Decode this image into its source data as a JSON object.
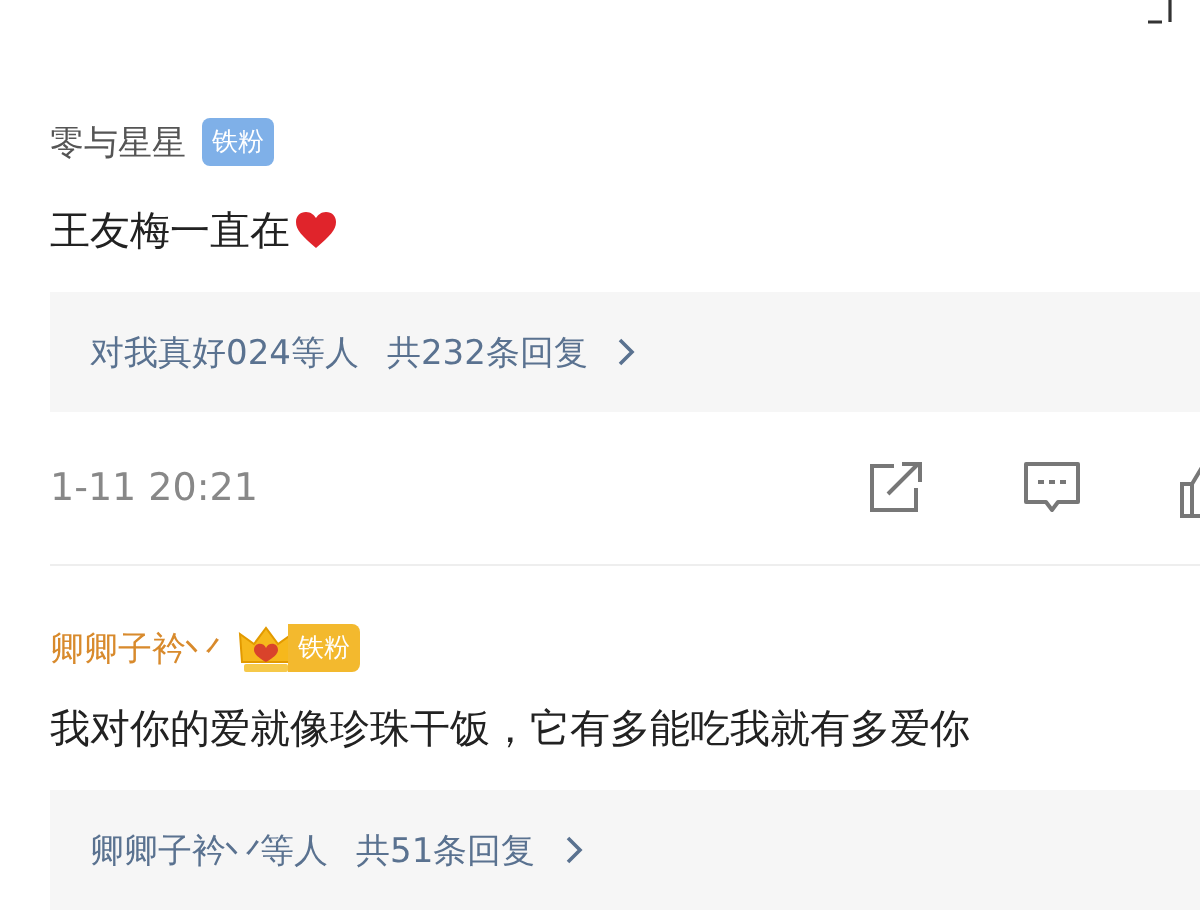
{
  "comments": [
    {
      "user": "零与星星",
      "badge": {
        "kind": "plain",
        "label": "铁粉"
      },
      "text": "王友梅一直在",
      "heart": true,
      "replies": {
        "users": "对我真好024等人",
        "count": "共232条回复"
      },
      "time": "1-11 20:21"
    },
    {
      "user": "卿卿子衿丷",
      "badge": {
        "kind": "crown",
        "label": "铁粉"
      },
      "text": "我对你的爱就像珍珠干饭，它有多能吃我就有多爱你",
      "replies": {
        "users": "卿卿子衿丷等人",
        "count": "共51条回复"
      }
    }
  ]
}
